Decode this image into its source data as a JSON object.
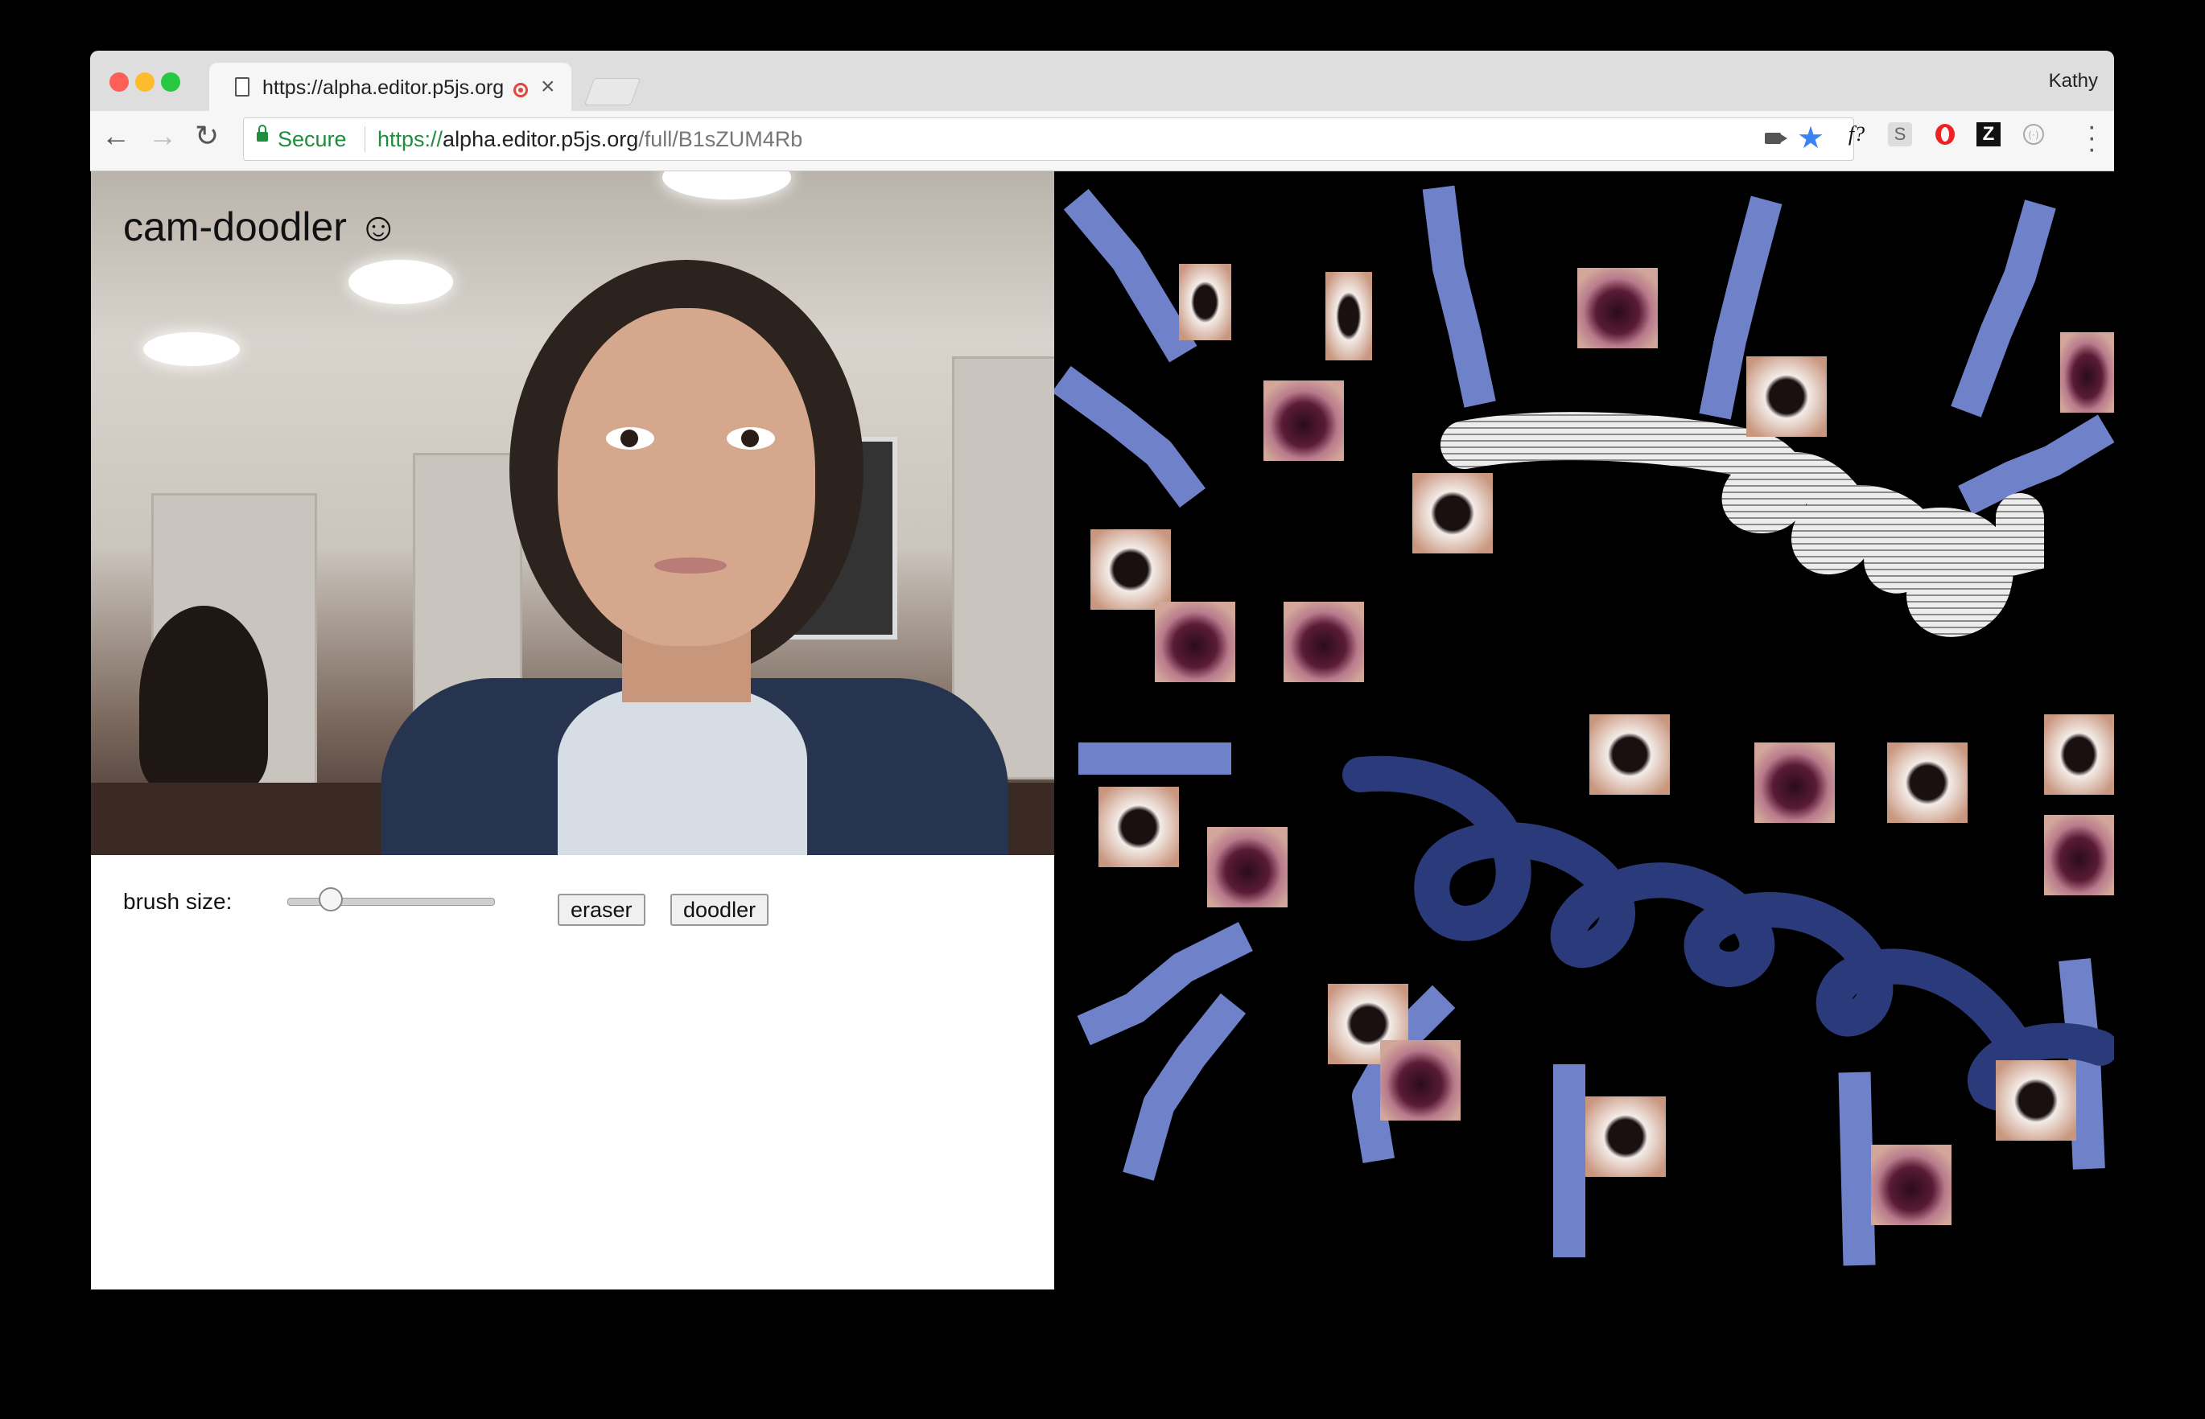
{
  "browser": {
    "tab_title": "https://alpha.editor.p5js.org",
    "profile_name": "Kathy",
    "security_label": "Secure",
    "url_scheme": "https://",
    "url_host": "alpha.editor.p5js.org",
    "url_path": "/full/B1sZUM4Rb",
    "extensions": [
      "f?",
      "S",
      "opera-icon",
      "Z",
      "pocket-icon"
    ]
  },
  "app": {
    "title": "cam-doodler ☺",
    "brush_label": "brush size:",
    "brush_size": 0.17,
    "eraser_label": "eraser",
    "doodler_label": "doodler"
  },
  "colors": {
    "stroke_light": "#6f82c9",
    "stroke_dark": "#2b3a7a",
    "stroke_white": "#f2f2f2",
    "accent_green": "#1e8e3e"
  }
}
